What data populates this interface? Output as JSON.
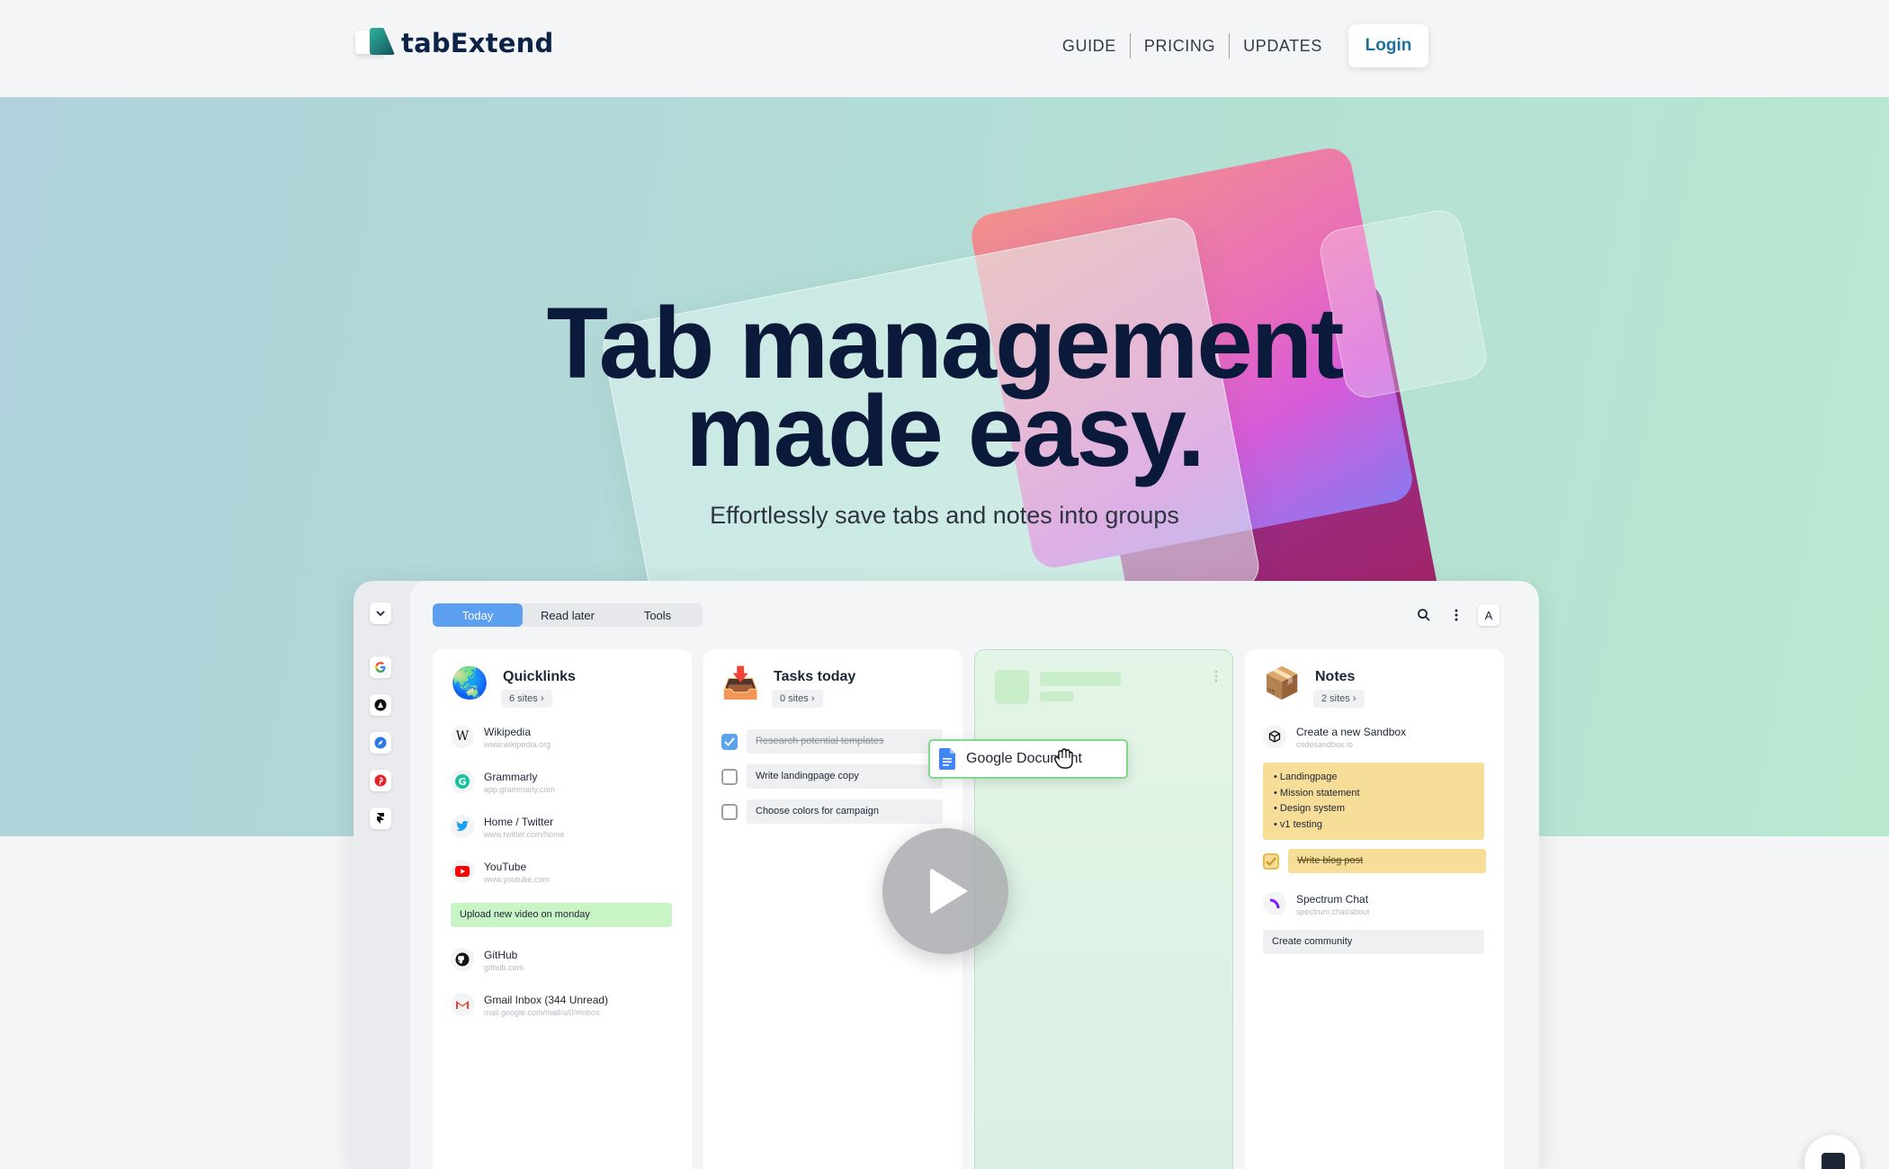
{
  "header": {
    "logo_text": "tabExtend",
    "nav": [
      "GUIDE",
      "PRICING",
      "UPDATES"
    ],
    "login_label": "Login"
  },
  "hero": {
    "title_line1": "Tab management",
    "title_line2": "made easy.",
    "subtitle": "Effortlessly save tabs and notes into groups"
  },
  "app": {
    "tabs": [
      "Today",
      "Read later",
      "Tools"
    ],
    "avatar_letter": "A",
    "sidebar_icons": [
      "google-icon",
      "arc-icon",
      "safari-icon",
      "pinterest-icon",
      "framer-icon"
    ],
    "quicklinks": {
      "title": "Quicklinks",
      "badge": "6 sites ›",
      "items": [
        {
          "title": "Wikipedia",
          "url": "www.wikipedia.org"
        },
        {
          "title": "Grammarly",
          "url": "app.grammarly.com"
        },
        {
          "title": "Home / Twitter",
          "url": "www.twitter.com/home"
        },
        {
          "title": "YouTube",
          "url": "www.youtube.com"
        },
        {
          "title": "GitHub",
          "url": "github.com"
        },
        {
          "title": "Gmail Inbox (344 Unread)",
          "url": "mail.google.com/mail/u/0/#inbox"
        }
      ],
      "note": "Upload new video on monday"
    },
    "tasks": {
      "title": "Tasks today",
      "badge": "0 sites ›",
      "items": [
        {
          "label": "Research potential templates",
          "done": true
        },
        {
          "label": "Write landingpage copy",
          "done": false
        },
        {
          "label": "Choose colors for campaign",
          "done": false
        }
      ]
    },
    "drag_card": {
      "label": "Google Document"
    },
    "notes": {
      "title": "Notes",
      "badge": "2 sites ›",
      "sandbox": {
        "title": "Create a new Sandbox",
        "url": "codesandbox.io"
      },
      "bullets": [
        "• Landingpage",
        "• Mission statement",
        "• Design system",
        "• v1 testing"
      ],
      "task": "Write blog post",
      "spectrum": {
        "title": "Spectrum Chat",
        "url": "spectrum.chat/about"
      },
      "community": "Create community"
    }
  },
  "colors": {
    "accent": "#5b9ff0",
    "brand_dark": "#0b1a3a",
    "login_text": "#1f6f9c",
    "note_yellow": "#f6dd98",
    "note_green": "#c8f4c6"
  }
}
